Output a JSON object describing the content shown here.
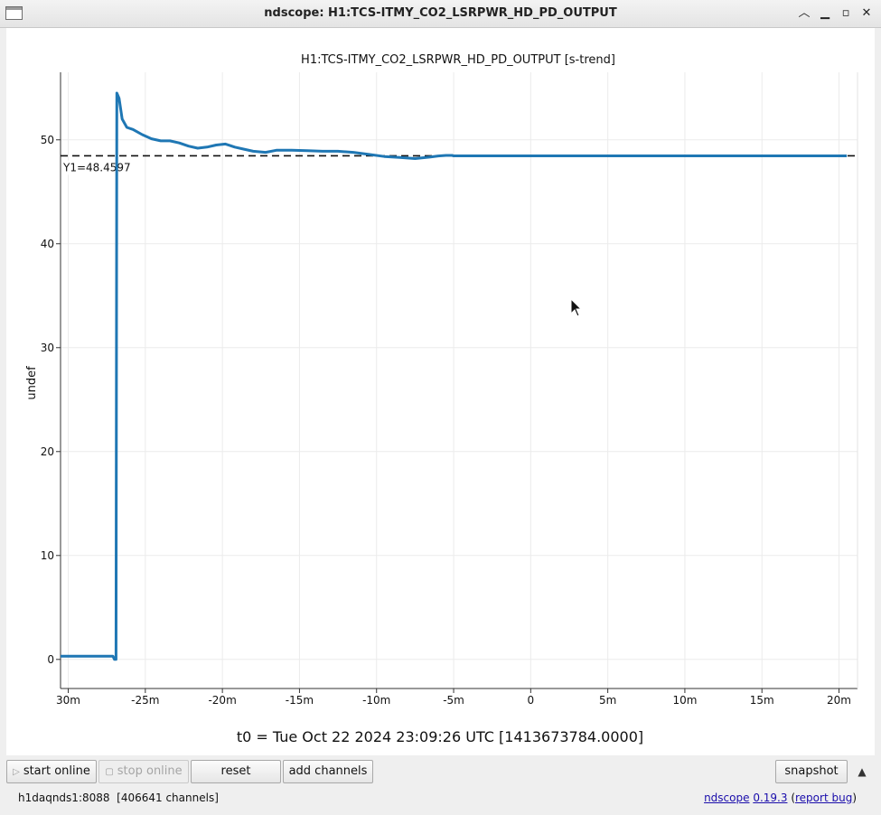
{
  "window": {
    "title": "ndscope: H1:TCS-ITMY_CO2_LSRPWR_HD_PD_OUTPUT",
    "controls": [
      "chevron-up-icon",
      "minimize-icon",
      "maximize-icon",
      "close-icon"
    ]
  },
  "plot": {
    "title": "H1:TCS-ITMY_CO2_LSRPWR_HD_PD_OUTPUT [s-trend]",
    "cursor_label": "Y1=48.4597",
    "t0_label": "t0 = Tue Oct 22 2024 23:09:26 UTC [1413673784.0000]"
  },
  "chart_data": {
    "type": "line",
    "title": "H1:TCS-ITMY_CO2_LSRPWR_HD_PD_OUTPUT [s-trend]",
    "xlabel": "",
    "ylabel": "undef",
    "x_unit": "minutes",
    "xlim": [
      -30.5,
      21.2
    ],
    "ylim": [
      -2.8,
      56.5
    ],
    "xticks": [
      -30,
      -25,
      -20,
      -15,
      -10,
      -5,
      0,
      5,
      10,
      15,
      20
    ],
    "xtick_labels": [
      "30m",
      "-25m",
      "-20m",
      "-15m",
      "-10m",
      "-5m",
      "0",
      "5m",
      "10m",
      "15m",
      "20m"
    ],
    "yticks": [
      0,
      10,
      20,
      30,
      40,
      50
    ],
    "grid": true,
    "cursor_y": 48.4597,
    "series": [
      {
        "color": "#1f77b4",
        "x": [
          -30.5,
          -27.1,
          -27.0,
          -26.9,
          -26.85,
          -26.7,
          -26.6,
          -26.5,
          -26.2,
          -25.8,
          -25.2,
          -24.6,
          -24.0,
          -23.4,
          -22.8,
          -22.2,
          -21.6,
          -21.0,
          -20.4,
          -19.8,
          -19.2,
          -18.6,
          -18.0,
          -17.2,
          -16.5,
          -15.5,
          -14.5,
          -13.5,
          -12.5,
          -11.5,
          -10.5,
          -9.5,
          -8.5,
          -7.5,
          -6.5,
          -6.0,
          -5.5,
          -5.1,
          -5.0,
          20.5
        ],
        "y": [
          0.3,
          0.3,
          0.0,
          0.0,
          54.5,
          54.0,
          53.0,
          52.0,
          51.2,
          51.0,
          50.5,
          50.1,
          49.9,
          49.9,
          49.7,
          49.4,
          49.2,
          49.3,
          49.5,
          49.6,
          49.3,
          49.1,
          48.9,
          48.8,
          49.0,
          49.0,
          48.95,
          48.9,
          48.9,
          48.8,
          48.6,
          48.4,
          48.3,
          48.2,
          48.35,
          48.45,
          48.5,
          48.5,
          48.46,
          48.46
        ]
      }
    ]
  },
  "toolbar": {
    "start_online": "start online",
    "stop_online": "stop online",
    "reset": "reset",
    "add_channels": "add channels",
    "snapshot": "snapshot"
  },
  "status": {
    "server": "h1daqnds1:8088  [406641 channels]",
    "app_name": "ndscope",
    "version": "0.19.3",
    "report_open": "(",
    "report_bug": "report bug",
    "report_close": ")"
  }
}
